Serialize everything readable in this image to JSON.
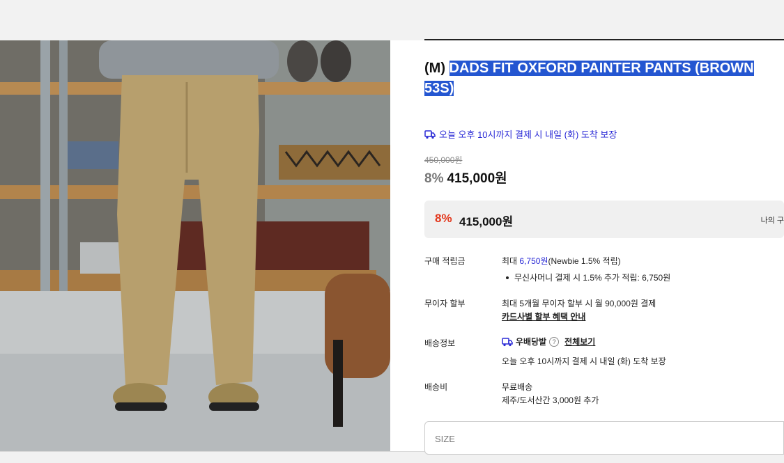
{
  "product": {
    "brand_prefix": "(M) ",
    "title_line1": "DADS FIT OXFORD PAINTER PANTS (BROWN",
    "title_line2": "53S)",
    "delivery_notice": "오늘 오후 10시까지 결제 시 내일 (화) 도착 보장",
    "original_price": "450,000원",
    "discount": "8%",
    "sale_price": "415,000원"
  },
  "price_box": {
    "discount": "8%",
    "price": "415,000원",
    "right_text": "나의 구"
  },
  "info": {
    "points_label": "구매 적립금",
    "points_prefix": "최대 ",
    "points_amount": "6,750원",
    "points_suffix": "(Newbie 1.5% 적립)",
    "points_bullet": "무신사머니 결제 시 1.5% 추가 적립: 6,750원",
    "installment_label": "무이자 할부",
    "installment_value": "최대 5개월 무이자 할부 시 월 90,000원 결제",
    "installment_link": "카드사별 할부 혜택 안내",
    "shipping_label": "배송정보",
    "shipping_badge": "우배당발",
    "shipping_view_all": "전체보기",
    "shipping_notice": "오늘 오후 10시까지 결제 시 내일 (화) 도착 보장",
    "fee_label": "배송비",
    "fee_value": "무료배송",
    "fee_extra": "제주/도서산간 3,000원 추가"
  },
  "size_select": {
    "placeholder": "SIZE"
  },
  "colors": {
    "accent_blue": "#2a2ad6",
    "discount_red": "#e2361b",
    "highlight": "#2456d1"
  },
  "icons": {
    "delivery": "truck-icon",
    "help": "question-circle-icon"
  }
}
